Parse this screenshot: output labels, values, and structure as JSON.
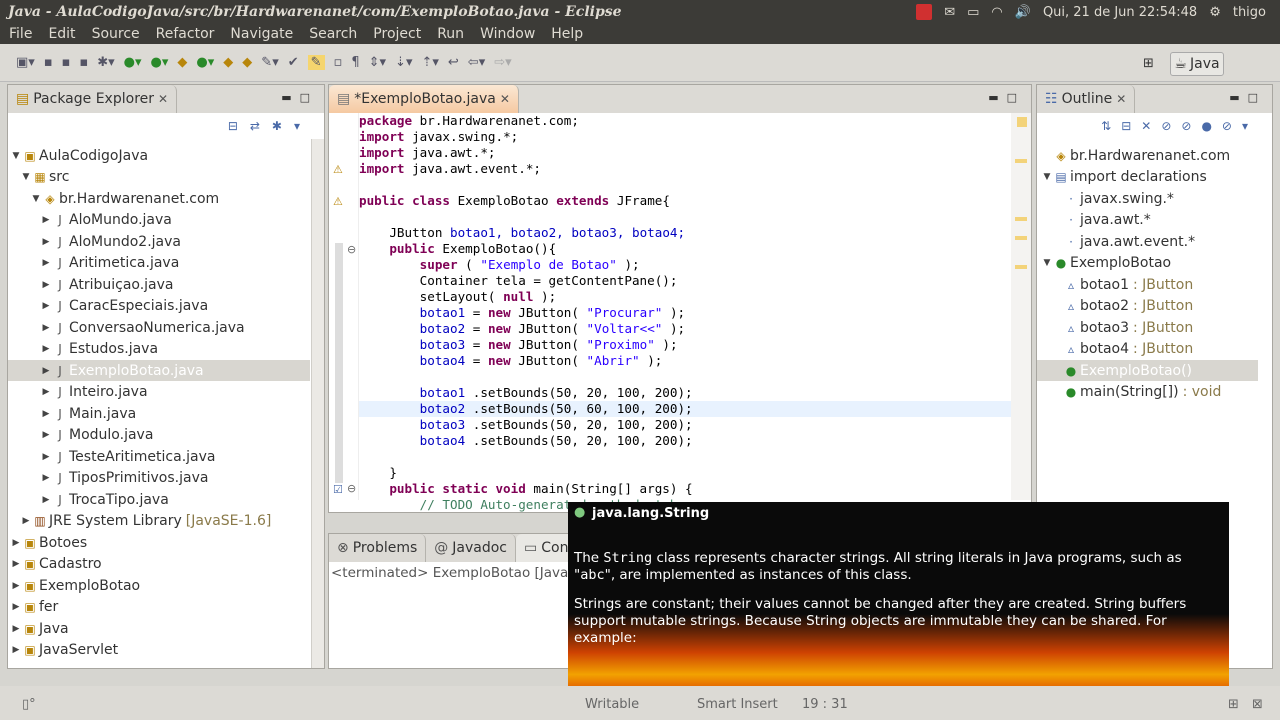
{
  "window": {
    "title": "Java - AulaCodigoJava/src/br/Hardwarenanet/com/ExemploBotao.java - Eclipse"
  },
  "tray": {
    "datetime": "Qui, 21 de Jun 22:54:48",
    "user": "thigo"
  },
  "menu": [
    "File",
    "Edit",
    "Source",
    "Refactor",
    "Navigate",
    "Search",
    "Project",
    "Run",
    "Window",
    "Help"
  ],
  "perspective": "Java",
  "package_explorer": {
    "tab": "Package Explorer",
    "rows": [
      {
        "label": "AulaCodigoJava",
        "indent": 0,
        "arrow": "▼",
        "icon": "project-icon"
      },
      {
        "label": "src",
        "indent": 1,
        "arrow": "▼",
        "icon": "folder-icon"
      },
      {
        "label": "br.Hardwarenanet.com",
        "indent": 2,
        "arrow": "▼",
        "icon": "package-icon"
      },
      {
        "label": "AloMundo.java",
        "indent": 3,
        "arrow": "▶",
        "icon": "java-file-icon"
      },
      {
        "label": "AloMundo2.java",
        "indent": 3,
        "arrow": "▶",
        "icon": "java-file-icon"
      },
      {
        "label": "Aritimetica.java",
        "indent": 3,
        "arrow": "▶",
        "icon": "java-file-icon"
      },
      {
        "label": "Atribuiçao.java",
        "indent": 3,
        "arrow": "▶",
        "icon": "java-file-icon"
      },
      {
        "label": "CaracEspeciais.java",
        "indent": 3,
        "arrow": "▶",
        "icon": "java-file-icon"
      },
      {
        "label": "ConversaoNumerica.java",
        "indent": 3,
        "arrow": "▶",
        "icon": "java-file-icon"
      },
      {
        "label": "Estudos.java",
        "indent": 3,
        "arrow": "▶",
        "icon": "java-file-icon"
      },
      {
        "label": "ExemploBotao.java",
        "indent": 3,
        "arrow": "▶",
        "icon": "java-file-icon",
        "selected": true
      },
      {
        "label": "Inteiro.java",
        "indent": 3,
        "arrow": "▶",
        "icon": "java-file-icon"
      },
      {
        "label": "Main.java",
        "indent": 3,
        "arrow": "▶",
        "icon": "java-file-icon"
      },
      {
        "label": "Modulo.java",
        "indent": 3,
        "arrow": "▶",
        "icon": "java-file-icon"
      },
      {
        "label": "TesteAritimetica.java",
        "indent": 3,
        "arrow": "▶",
        "icon": "java-file-icon"
      },
      {
        "label": "TiposPrimitivos.java",
        "indent": 3,
        "arrow": "▶",
        "icon": "java-file-icon"
      },
      {
        "label": "TrocaTipo.java",
        "indent": 3,
        "arrow": "▶",
        "icon": "java-file-icon"
      },
      {
        "label": "JRE System Library",
        "suffix": "[JavaSE-1.6]",
        "indent": 1,
        "arrow": "▶",
        "icon": "library-icon"
      },
      {
        "label": "Botoes",
        "indent": 0,
        "arrow": "▶",
        "icon": "project-icon"
      },
      {
        "label": "Cadastro",
        "indent": 0,
        "arrow": "▶",
        "icon": "project-icon"
      },
      {
        "label": "ExemploBotao",
        "indent": 0,
        "arrow": "▶",
        "icon": "project-icon"
      },
      {
        "label": "fer",
        "indent": 0,
        "arrow": "▶",
        "icon": "project-icon"
      },
      {
        "label": "Java",
        "indent": 0,
        "arrow": "▶",
        "icon": "project-icon"
      },
      {
        "label": "JavaServlet",
        "indent": 0,
        "arrow": "▶",
        "icon": "project-icon"
      }
    ]
  },
  "editor": {
    "tab": "*ExemploBotao.java",
    "lines": [
      [
        [
          "kw",
          "package"
        ],
        [
          "",
          "br.Hardwarenanet.com;"
        ]
      ],
      [
        [
          "kw",
          "import"
        ],
        [
          "",
          "javax.swing.*;"
        ]
      ],
      [
        [
          "kw",
          "import"
        ],
        [
          "",
          "java.awt.*;"
        ]
      ],
      [
        [
          "kw",
          "import"
        ],
        [
          "",
          "java.awt.event.*;"
        ]
      ],
      [],
      [
        [
          "kw",
          "public class"
        ],
        [
          "",
          "ExemploBotao"
        ],
        [
          "kw",
          "extends"
        ],
        [
          "",
          "JFrame{"
        ]
      ],
      [],
      [
        [
          "",
          "    JButton"
        ],
        [
          "fld",
          "botao1,"
        ],
        [
          "fld",
          "botao2,"
        ],
        [
          "fld",
          "botao3,"
        ],
        [
          "fld",
          "botao4;"
        ]
      ],
      [
        [
          "kw",
          "    public"
        ],
        [
          "",
          "ExemploBotao(){"
        ]
      ],
      [
        [
          "kw",
          "        super"
        ],
        [
          "",
          "("
        ],
        [
          "str",
          "\"Exemplo de Botao\""
        ],
        [
          "",
          ");"
        ]
      ],
      [
        [
          "",
          "        Container tela = getContentPane();"
        ]
      ],
      [
        [
          "",
          "        setLayout("
        ],
        [
          "kw",
          "null"
        ],
        [
          "",
          ");"
        ]
      ],
      [
        [
          "fld",
          "        botao1"
        ],
        [
          "",
          "="
        ],
        [
          "kw",
          "new"
        ],
        [
          "",
          "JButton("
        ],
        [
          "str",
          "\"Procurar\""
        ],
        [
          "",
          ");"
        ]
      ],
      [
        [
          "fld",
          "        botao2"
        ],
        [
          "",
          "="
        ],
        [
          "kw",
          "new"
        ],
        [
          "",
          "JButton("
        ],
        [
          "str",
          "\"Voltar<<\""
        ],
        [
          "",
          ");"
        ]
      ],
      [
        [
          "fld",
          "        botao3"
        ],
        [
          "",
          "="
        ],
        [
          "kw",
          "new"
        ],
        [
          "",
          "JButton("
        ],
        [
          "str",
          "\"Proximo\""
        ],
        [
          "",
          ");"
        ]
      ],
      [
        [
          "fld",
          "        botao4"
        ],
        [
          "",
          "="
        ],
        [
          "kw",
          "new"
        ],
        [
          "",
          "JButton("
        ],
        [
          "str",
          "\"Abrir\""
        ],
        [
          "",
          ");"
        ]
      ],
      [],
      [
        [
          "fld",
          "        botao1"
        ],
        [
          "",
          ".setBounds(50, 20, 100, 200);"
        ]
      ],
      [
        [
          "fld",
          "        botao2"
        ],
        [
          "",
          ".setBounds(50, 60, 100, 200);"
        ]
      ],
      [
        [
          "fld",
          "        botao3"
        ],
        [
          "",
          ".setBounds(50, 20, 100, 200);"
        ]
      ],
      [
        [
          "fld",
          "        botao4"
        ],
        [
          "",
          ".setBounds(50, 20, 100, 200);"
        ]
      ],
      [],
      [
        [
          "",
          "    }"
        ]
      ],
      [
        [
          "kw",
          "    public static void"
        ],
        [
          "",
          "main(String[] args) {"
        ]
      ],
      [
        [
          "cmt",
          "        // TODO Auto-generated method stub"
        ]
      ]
    ]
  },
  "outline": {
    "tab": "Outline",
    "rows": [
      {
        "label": "br.Hardwarenanet.com",
        "indent": 0,
        "icon": "package-icon"
      },
      {
        "label": "import declarations",
        "indent": 0,
        "arrow": "▼",
        "icon": "imports-icon"
      },
      {
        "label": "javax.swing.*",
        "indent": 1,
        "icon": "import-icon"
      },
      {
        "label": "java.awt.*",
        "indent": 1,
        "icon": "import-icon"
      },
      {
        "label": "java.awt.event.*",
        "indent": 1,
        "icon": "import-icon"
      },
      {
        "label": "ExemploBotao",
        "indent": 0,
        "arrow": "▼",
        "icon": "class-icon"
      },
      {
        "label": "botao1",
        "type": ": JButton",
        "indent": 1,
        "icon": "field-icon"
      },
      {
        "label": "botao2",
        "type": ": JButton",
        "indent": 1,
        "icon": "field-icon"
      },
      {
        "label": "botao3",
        "type": ": JButton",
        "indent": 1,
        "icon": "field-icon"
      },
      {
        "label": "botao4",
        "type": ": JButton",
        "indent": 1,
        "icon": "field-icon"
      },
      {
        "label": "ExemploBotao()",
        "indent": 1,
        "icon": "constructor-icon",
        "selected": true
      },
      {
        "label": "main(String[])",
        "type": ": void",
        "indent": 1,
        "icon": "method-icon"
      }
    ]
  },
  "bottom": {
    "tabs": [
      "Problems",
      "Javadoc",
      "Console"
    ],
    "console_text": "<terminated> ExemploBotao [Java Ap"
  },
  "tooltip": {
    "header": "java.lang.String",
    "p1_before": "The ",
    "p1_code": "String",
    "p1_after": " class represents character strings. All string literals in Java programs, such as \"",
    "p1_code2": "abc",
    "p1_end": "\", are implemented as instances of this class.",
    "p2": "Strings are constant; their values cannot be changed after they are created. String buffers support mutable strings. Because String objects are immutable they can be shared. For example:"
  },
  "status": {
    "writable": "Writable",
    "insert": "Smart Insert",
    "position": "19 : 31"
  }
}
